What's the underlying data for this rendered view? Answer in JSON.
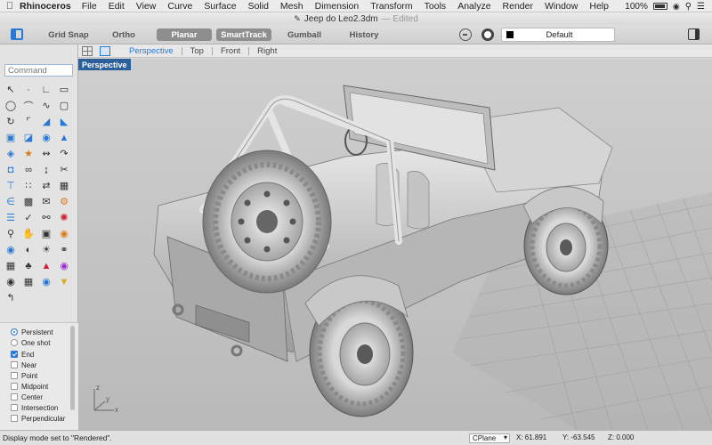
{
  "menubar": {
    "app_name": "Rhinoceros",
    "items": [
      "File",
      "Edit",
      "View",
      "Curve",
      "Surface",
      "Solid",
      "Mesh",
      "Dimension",
      "Transform",
      "Tools",
      "Analyze",
      "Render",
      "Window",
      "Help"
    ],
    "battery": "100%"
  },
  "window": {
    "title": "Jeep do Leo2.3dm",
    "status": "— Edited"
  },
  "toolbar": {
    "grid_snap": "Grid Snap",
    "ortho": "Ortho",
    "planar": "Planar",
    "smarttrack": "SmartTrack",
    "gumball": "Gumball",
    "history": "History",
    "layer": "Default",
    "layer_color": "#000000"
  },
  "viewport_tabs": {
    "items": [
      "Perspective",
      "Top",
      "Front",
      "Right"
    ],
    "active": "Perspective"
  },
  "command": {
    "placeholder": "Command"
  },
  "tool_icons": [
    "select-arrow-icon",
    "point-icon",
    "polyline-icon",
    "rectangle-icon",
    "circle-icon",
    "arc-icon",
    "curve-icon",
    "rectangle-rounded-icon",
    "rotate-icon",
    "fillet-icon",
    "surface-icon",
    "patch-icon",
    "box-icon",
    "cylinder-icon",
    "sphere-icon",
    "extrude-icon",
    "boolean-icon",
    "revolve-icon",
    "loft-icon",
    "sweep-icon",
    "solid-edit-icon",
    "blend-icon",
    "offset-icon",
    "trim-icon",
    "dimension-icon",
    "array-icon",
    "mirror-icon",
    "group-icon",
    "text-icon",
    "hatch-icon",
    "annotation-icon",
    "properties-icon",
    "layer-icon",
    "check-icon",
    "join-icon",
    "explode-icon",
    "zoom-icon",
    "pan-icon",
    "analyze-icon",
    "measure-icon",
    "render-icon",
    "material-icon",
    "light-icon",
    "camera-icon",
    "mesh-icon",
    "lock-icon",
    "paint-icon",
    "color-wheel-icon",
    "sphere-render-icon",
    "grid-icon",
    "environment-icon",
    "light-bulb-icon",
    "distribute-icon"
  ],
  "osnaps": [
    {
      "label": "Persistent",
      "kind": "radio",
      "on": true
    },
    {
      "label": "One shot",
      "kind": "radio",
      "on": false
    },
    {
      "label": "End",
      "kind": "check",
      "on": true
    },
    {
      "label": "Near",
      "kind": "check",
      "on": false
    },
    {
      "label": "Point",
      "kind": "check",
      "on": false
    },
    {
      "label": "Midpoint",
      "kind": "check",
      "on": false
    },
    {
      "label": "Center",
      "kind": "check",
      "on": false
    },
    {
      "label": "Intersection",
      "kind": "check",
      "on": false
    },
    {
      "label": "Perpendicular",
      "kind": "check",
      "on": false
    }
  ],
  "viewport": {
    "label": "Perspective",
    "axis_x": "x",
    "axis_y": "y",
    "axis_z": "z"
  },
  "statusbar": {
    "message": "Display mode set to \"Rendered\".",
    "cplane": "CPlane",
    "x": "X: 61.891",
    "y": "Y: -63.545",
    "z": "Z: 0.000"
  }
}
